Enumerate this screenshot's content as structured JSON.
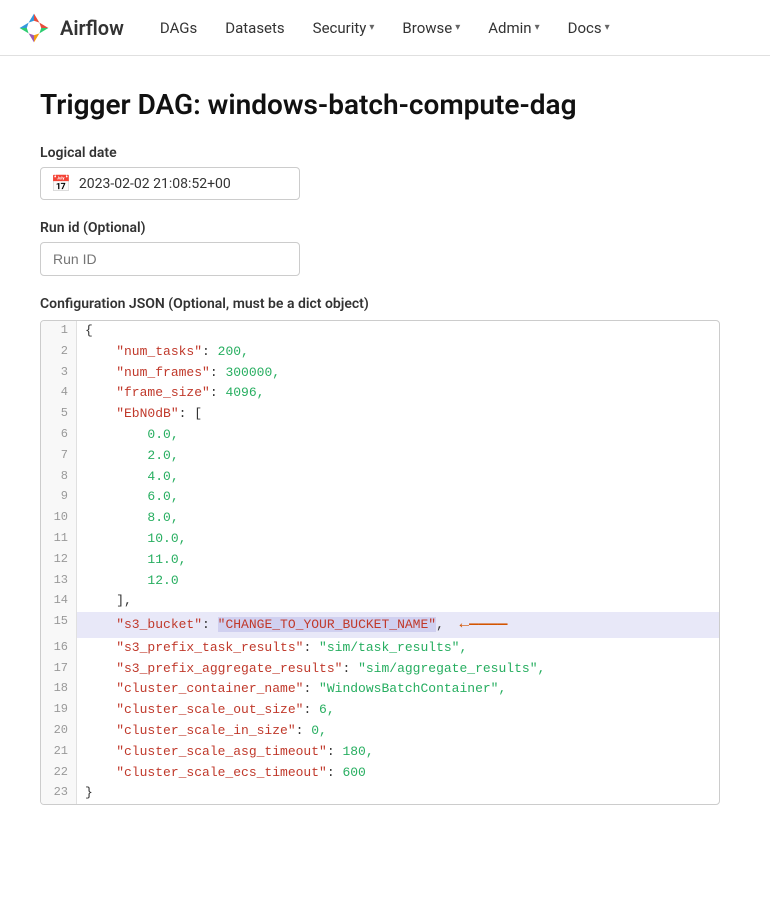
{
  "brand": {
    "name": "Airflow",
    "logo_alt": "Airflow logo"
  },
  "navbar": {
    "items": [
      {
        "label": "DAGs",
        "has_dropdown": false
      },
      {
        "label": "Datasets",
        "has_dropdown": false
      },
      {
        "label": "Security",
        "has_dropdown": true
      },
      {
        "label": "Browse",
        "has_dropdown": true
      },
      {
        "label": "Admin",
        "has_dropdown": true
      },
      {
        "label": "Docs",
        "has_dropdown": true
      }
    ]
  },
  "page": {
    "title": "Trigger DAG: windows-batch-compute-dag",
    "logical_date_label": "Logical date",
    "logical_date_value": "2023-02-02 21:08:52+00",
    "run_id_label": "Run id (Optional)",
    "run_id_placeholder": "Run ID",
    "config_label": "Configuration JSON (Optional, must be a dict object)"
  },
  "json_lines": [
    {
      "num": 1,
      "content": "{",
      "type": "plain"
    },
    {
      "num": 2,
      "key": "\"num_tasks\"",
      "sep": ": ",
      "val": "200,",
      "val_type": "num"
    },
    {
      "num": 3,
      "key": "\"num_frames\"",
      "sep": ": ",
      "val": "300000,",
      "val_type": "num"
    },
    {
      "num": 4,
      "key": "\"frame_size\"",
      "sep": ": ",
      "val": "4096,",
      "val_type": "num"
    },
    {
      "num": 5,
      "key": "\"EbN0dB\"",
      "sep": ": ",
      "val": "[",
      "val_type": "punc"
    },
    {
      "num": 6,
      "indent": "        ",
      "val": "0.0,",
      "val_type": "num"
    },
    {
      "num": 7,
      "indent": "        ",
      "val": "2.0,",
      "val_type": "num"
    },
    {
      "num": 8,
      "indent": "        ",
      "val": "4.0,",
      "val_type": "num"
    },
    {
      "num": 9,
      "indent": "        ",
      "val": "6.0,",
      "val_type": "num"
    },
    {
      "num": 10,
      "indent": "        ",
      "val": "8.0,",
      "val_type": "num"
    },
    {
      "num": 11,
      "indent": "        ",
      "val": "10.0,",
      "val_type": "num"
    },
    {
      "num": 12,
      "indent": "        ",
      "val": "11.0,",
      "val_type": "num"
    },
    {
      "num": 13,
      "indent": "        ",
      "val": "12.0",
      "val_type": "num"
    },
    {
      "num": 14,
      "indent": "    ",
      "val": "],",
      "val_type": "punc"
    },
    {
      "num": 15,
      "key": "\"s3_bucket\"",
      "sep": ": ",
      "val": "\"CHANGE_TO_YOUR_BUCKET_NAME\",",
      "val_type": "str",
      "highlight": true
    },
    {
      "num": 16,
      "key": "\"s3_prefix_task_results\"",
      "sep": ": ",
      "val": "\"sim/task_results\",",
      "val_type": "str"
    },
    {
      "num": 17,
      "key": "\"s3_prefix_aggregate_results\"",
      "sep": ": ",
      "val": "\"sim/aggregate_results\",",
      "val_type": "str"
    },
    {
      "num": 18,
      "key": "\"cluster_container_name\"",
      "sep": ": ",
      "val": "\"WindowsBatchContainer\",",
      "val_type": "str"
    },
    {
      "num": 19,
      "key": "\"cluster_scale_out_size\"",
      "sep": ": ",
      "val": "6,",
      "val_type": "num"
    },
    {
      "num": 20,
      "key": "\"cluster_scale_in_size\"",
      "sep": ": ",
      "val": "0,",
      "val_type": "num"
    },
    {
      "num": 21,
      "key": "\"cluster_scale_asg_timeout\"",
      "sep": ": ",
      "val": "180,",
      "val_type": "num"
    },
    {
      "num": 22,
      "key": "\"cluster_scale_ecs_timeout\"",
      "sep": ": ",
      "val": "600",
      "val_type": "num"
    },
    {
      "num": 23,
      "content": "}",
      "type": "plain"
    }
  ]
}
